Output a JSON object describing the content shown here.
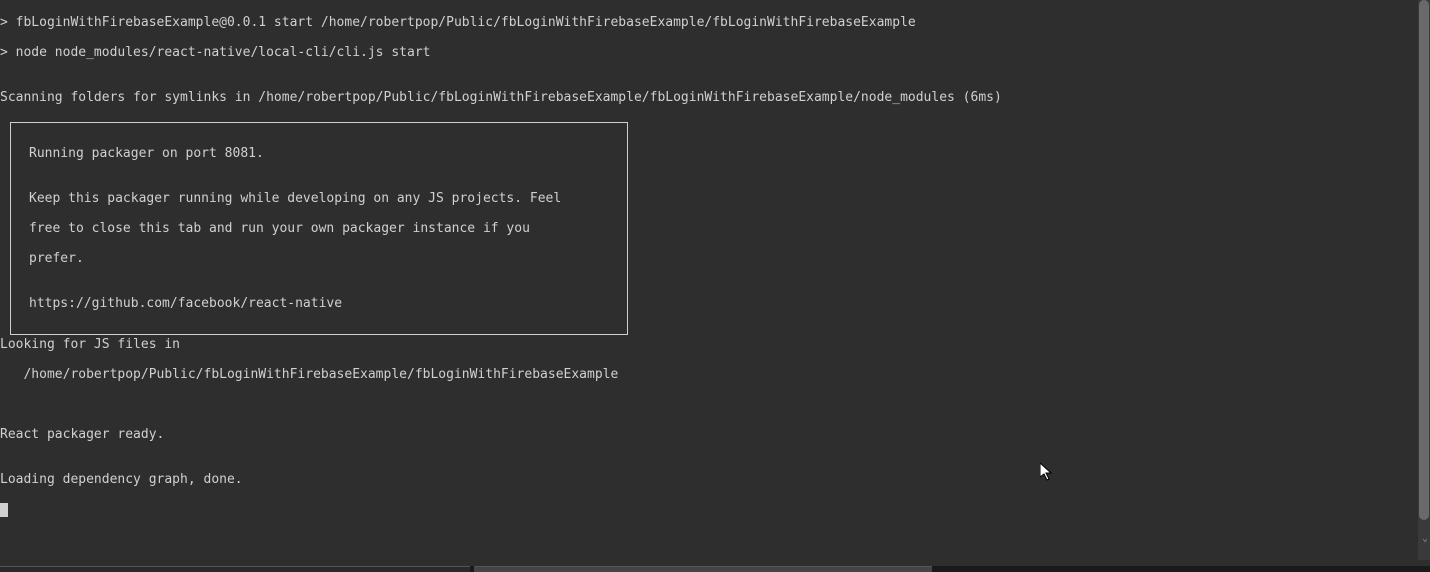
{
  "terminal": {
    "line1": "> fbLoginWithFirebaseExample@0.0.1 start /home/robertpop/Public/fbLoginWithFirebaseExample/fbLoginWithFirebaseExample",
    "line2": "> node node_modules/react-native/local-cli/cli.js start",
    "blank1": "",
    "line3": "Scanning folders for symlinks in /home/robertpop/Public/fbLoginWithFirebaseExample/fbLoginWithFirebaseExample/node_modules (6ms)",
    "box": {
      "l1": "Running packager on port 8081.",
      "l2": "",
      "l3": "Keep this packager running while developing on any JS projects. Feel",
      "l4": "free to close this tab and run your own packager instance if you",
      "l5": "prefer.",
      "l6": "",
      "l7": "https://github.com/facebook/react-native"
    },
    "line4": "Looking for JS files in",
    "line5": "   /home/robertpop/Public/fbLoginWithFirebaseExample/fbLoginWithFirebaseExample ",
    "blank2": "",
    "blank3": "",
    "line6": "React packager ready.",
    "blank4": "",
    "line7": "Loading dependency graph, done."
  }
}
